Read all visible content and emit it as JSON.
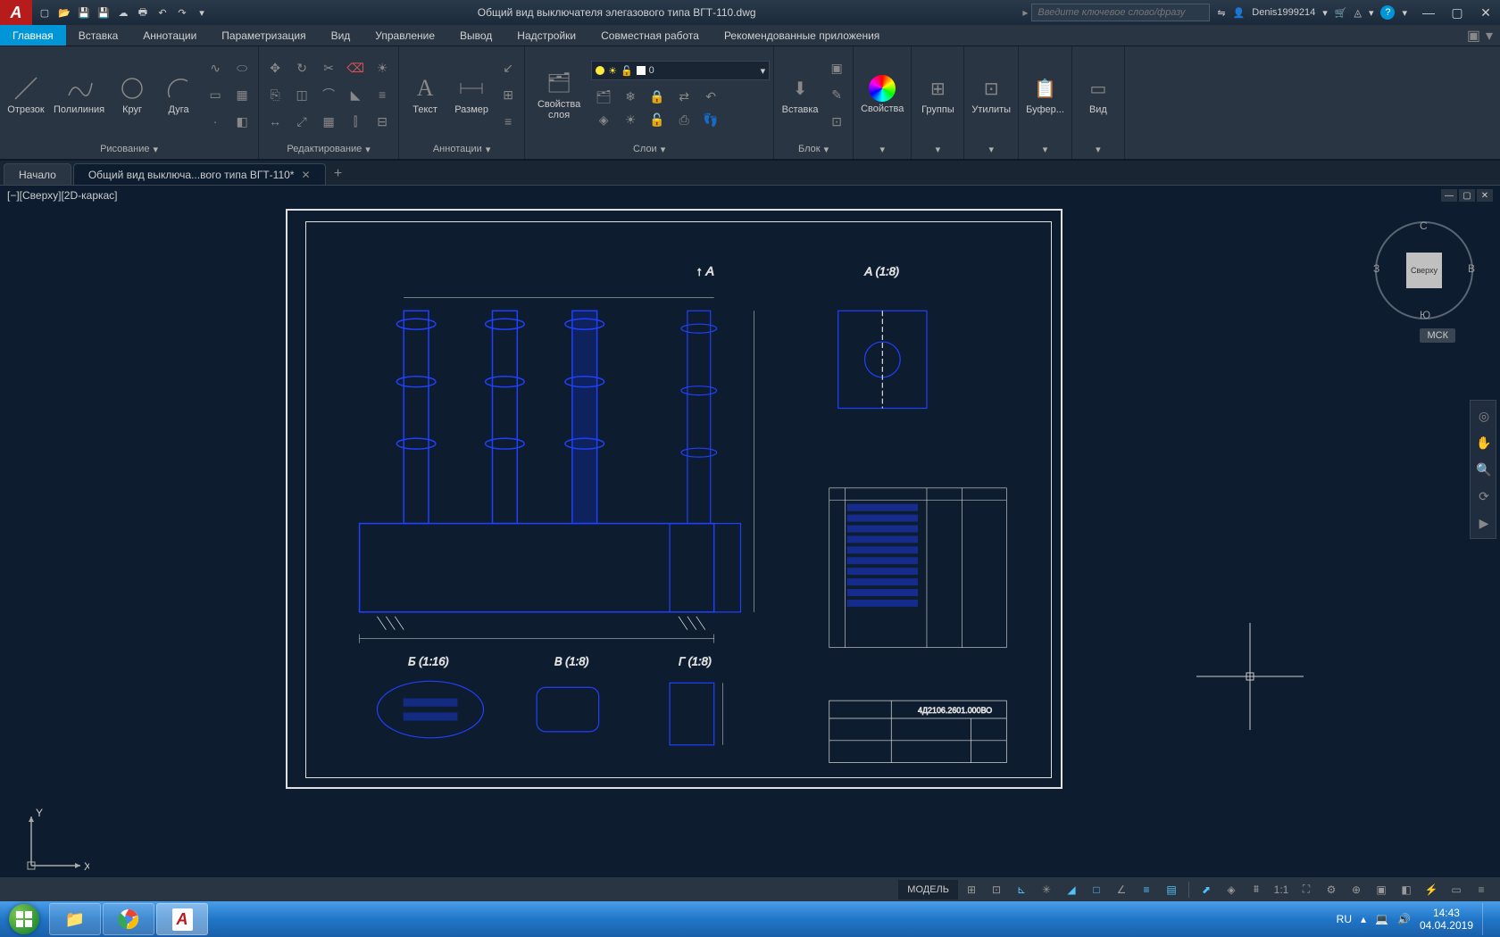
{
  "title": "Общий вид выключателя элегазового типа ВГТ-110.dwg",
  "search_placeholder": "Введите ключевое слово/фразу",
  "user": "Denis1999214",
  "ribbon_tabs": [
    "Главная",
    "Вставка",
    "Аннотации",
    "Параметризация",
    "Вид",
    "Управление",
    "Вывод",
    "Надстройки",
    "Совместная работа",
    "Рекомендованные приложения"
  ],
  "panels": {
    "draw": {
      "title": "Рисование",
      "line": "Отрезок",
      "polyline": "Полилиния",
      "circle": "Круг",
      "arc": "Дуга"
    },
    "modify": {
      "title": "Редактирование"
    },
    "annotation": {
      "title": "Аннотации",
      "text": "Текст",
      "dim": "Размер"
    },
    "layers": {
      "title": "Слои",
      "props": "Свойства слоя",
      "current": "0"
    },
    "block": {
      "title": "Блок",
      "insert": "Вставка"
    },
    "properties": {
      "title": "Свойства"
    },
    "groups": {
      "title": "Группы"
    },
    "utilities": {
      "title": "Утилиты"
    },
    "clipboard": {
      "title": "Буфер..."
    },
    "view": {
      "title": "Вид"
    }
  },
  "doc_tabs": {
    "start": "Начало",
    "file": "Общий вид выключа...вого типа ВГТ-110*"
  },
  "viewport_label": "[−][Сверху][2D-каркас]",
  "viewcube": {
    "face": "Сверху",
    "n": "С",
    "s": "Ю",
    "e": "В",
    "w": "З"
  },
  "wcs": "МСК",
  "drawing_labels": {
    "A": "↑ А",
    "Av": "А (1:8)",
    "B": "Б",
    "Bv": "Б (1:16)",
    "V": "В",
    "Vv": "В (1:8)",
    "G": "Г",
    "Gv": "Г (1:8)",
    "code": "4Д2106.2601.000ВО"
  },
  "status": {
    "model": "МОДЕЛЬ",
    "scale": "1:1"
  },
  "tray": {
    "lang": "RU",
    "time": "14:43",
    "date": "04.04.2019"
  },
  "ucs": {
    "x": "X",
    "y": "Y"
  }
}
